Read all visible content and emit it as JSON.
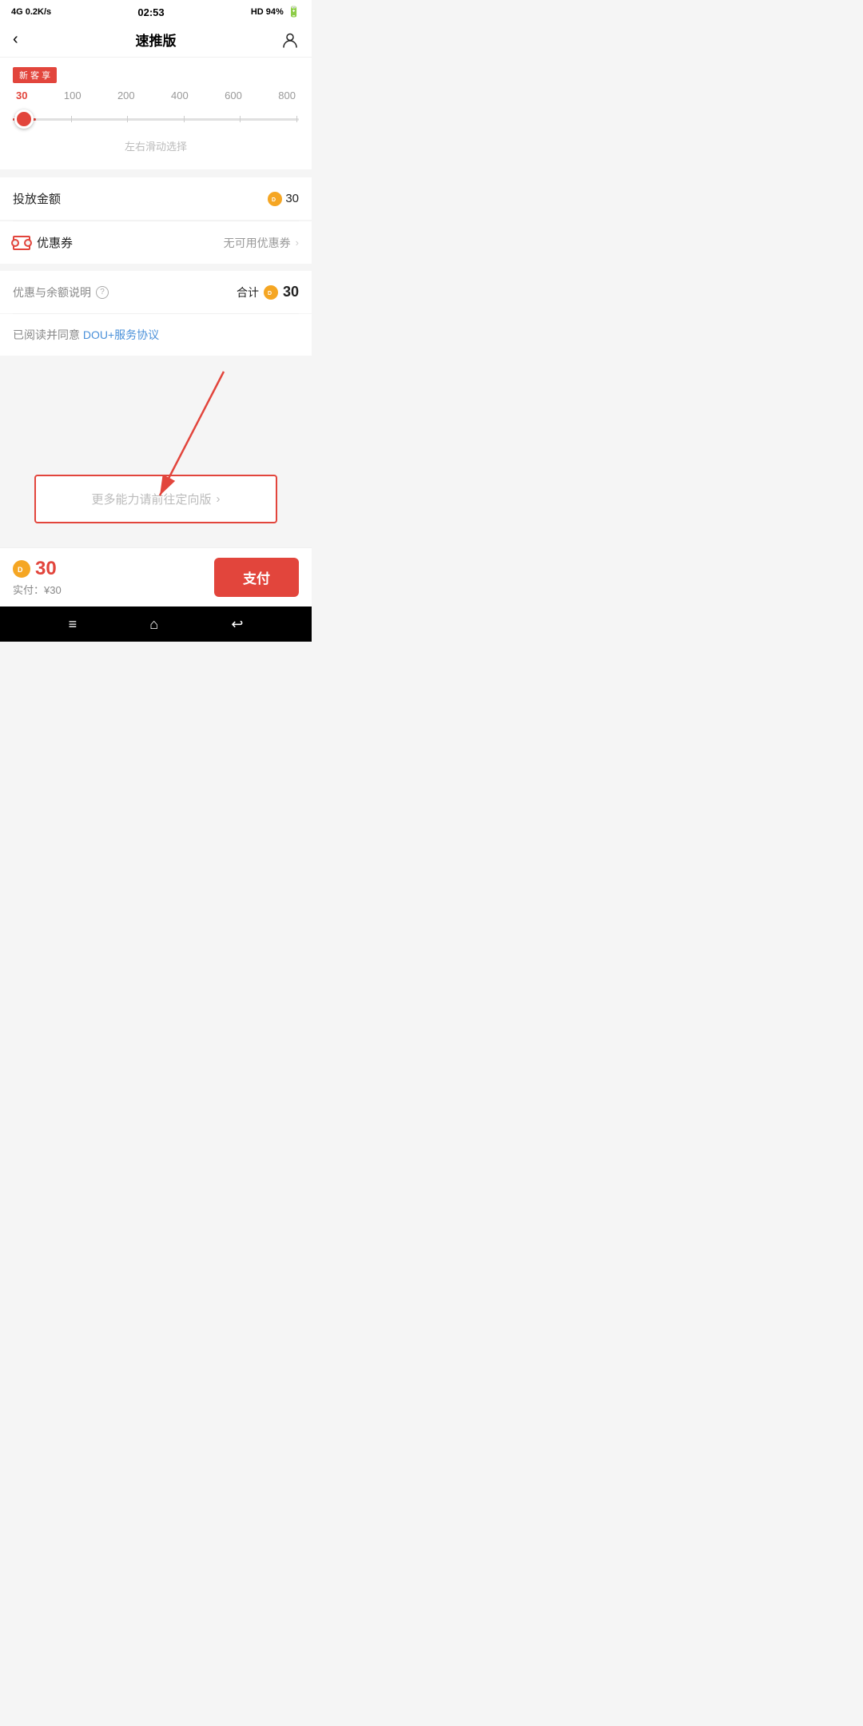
{
  "statusBar": {
    "left": "4G  0.2K/s",
    "center": "02:53",
    "right": "HD  94%"
  },
  "navBar": {
    "back": "‹",
    "title": "速推版",
    "userIcon": "person"
  },
  "slider": {
    "badge": "新 客 享",
    "numbers": [
      "30",
      "100",
      "200",
      "400",
      "600",
      "800"
    ],
    "hint": "左右滑动选择",
    "currentValue": "30"
  },
  "amountRow": {
    "label": "投放金额",
    "amount": "30"
  },
  "couponRow": {
    "label": "优惠券",
    "value": "无可用优惠券"
  },
  "summaryRow": {
    "label": "优惠与余额说明",
    "totalLabel": "合计",
    "totalAmount": "30"
  },
  "agreement": {
    "prefix": "已阅读并同意 ",
    "linkText": "DOU+服务协议"
  },
  "redirectBtn": {
    "label": "更多能力请前往定向版",
    "chevron": "›"
  },
  "bottomBar": {
    "amount": "30",
    "actualLabel": "实付：¥30",
    "payLabel": "支付"
  },
  "systemNav": {
    "menu": "≡",
    "home": "⌂",
    "back": "↩"
  }
}
